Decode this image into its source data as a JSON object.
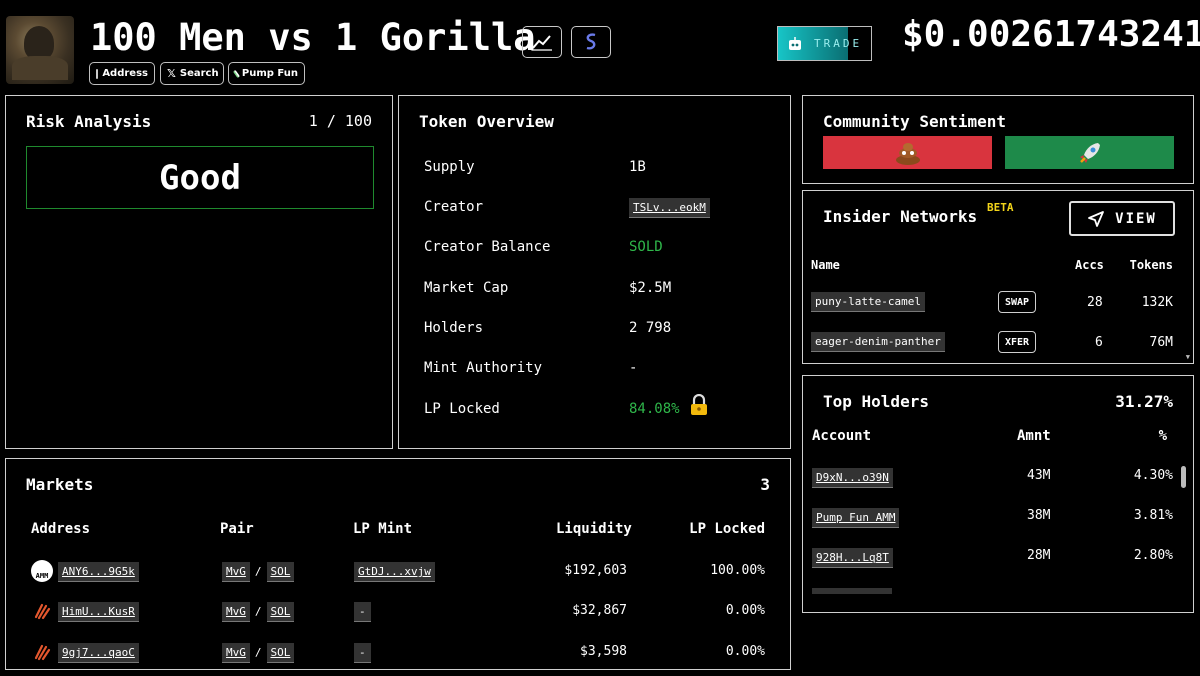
{
  "header": {
    "title": "100 Men vs 1 Gorilla",
    "links": [
      {
        "label": "Address",
        "icon": "copy-icon"
      },
      {
        "label": "Search",
        "icon": "x-logo-icon"
      },
      {
        "label": "Pump Fun",
        "icon": "pill-icon"
      }
    ],
    "trade_label": "TRADE",
    "price": "$0.00261743241"
  },
  "risk": {
    "title": "Risk Analysis",
    "score": "1 / 100",
    "rating": "Good"
  },
  "overview": {
    "title": "Token Overview",
    "rows": [
      {
        "label": "Supply",
        "value": "1B"
      },
      {
        "label": "Creator",
        "value": "TSLv...eokM"
      },
      {
        "label": "Creator Balance",
        "value": "SOLD"
      },
      {
        "label": "Market Cap",
        "value": "$2.5M"
      },
      {
        "label": "Holders",
        "value": "2 798"
      },
      {
        "label": "Mint Authority",
        "value": "-"
      },
      {
        "label": "LP Locked",
        "value": "84.08%"
      }
    ]
  },
  "sentiment": {
    "title": "Community Sentiment",
    "colors": {
      "bad": "#d9343e",
      "good": "#1e8a4a"
    }
  },
  "insider": {
    "title": "Insider Networks",
    "badge": "BETA",
    "view_label": "VIEW",
    "headers": {
      "name": "Name",
      "accs": "Accs",
      "tokens": "Tokens"
    },
    "rows": [
      {
        "name": "puny-latte-camel",
        "tag": "SWAP",
        "accs": "28",
        "tokens": "132K"
      },
      {
        "name": "eager-denim-panther",
        "tag": "XFER",
        "accs": "6",
        "tokens": "76M"
      }
    ]
  },
  "holders": {
    "title": "Top Holders",
    "total": "31.27%",
    "headers": {
      "account": "Account",
      "amount": "Amnt",
      "pct": "%"
    },
    "rows": [
      {
        "account": "D9xN...o39N",
        "amount": "43M",
        "pct": "4.30%"
      },
      {
        "account": "Pump Fun AMM",
        "amount": "38M",
        "pct": "3.81%"
      },
      {
        "account": "928H...Lq8T",
        "amount": "28M",
        "pct": "2.80%"
      }
    ]
  },
  "markets": {
    "title": "Markets",
    "count": "3",
    "headers": {
      "address": "Address",
      "pair": "Pair",
      "lpmint": "LP Mint",
      "liquidity": "Liquidity",
      "lplocked": "LP Locked"
    },
    "rows": [
      {
        "address": "ANY6...9G5k",
        "base": "MvG",
        "sep": "/",
        "quote": "SOL",
        "lpmint": "GtDJ...xvjw",
        "liquidity": "$192,603",
        "lplocked": "100.00%",
        "icon": "amm-icon"
      },
      {
        "address": "HimU...KusR",
        "base": "MvG",
        "sep": "/",
        "quote": "SOL",
        "lpmint": "-",
        "liquidity": "$32,867",
        "lplocked": "0.00%",
        "icon": "meteora-icon"
      },
      {
        "address": "9gj7...qaoC",
        "base": "MvG",
        "sep": "/",
        "quote": "SOL",
        "lpmint": "-",
        "liquidity": "$3,598",
        "lplocked": "0.00%",
        "icon": "meteora-icon"
      }
    ]
  }
}
